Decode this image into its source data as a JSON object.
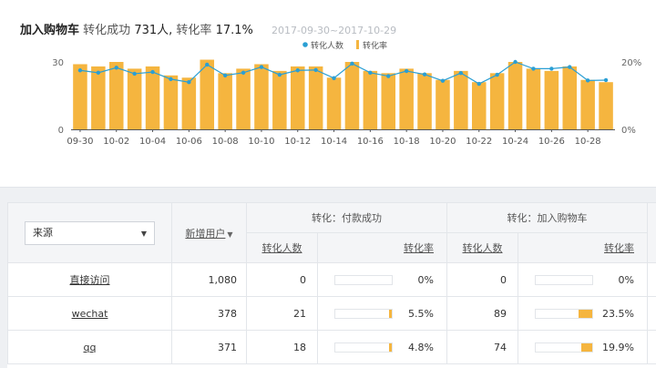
{
  "headline": {
    "title": "加入购物车",
    "conv_label": "转化成功",
    "conv_count": "731人,",
    "rate_label": "转化率",
    "rate_value": "17.1%",
    "date_range": "2017-09-30~2017-10-29"
  },
  "chart_data": {
    "type": "bar",
    "legend_placement": "top-center",
    "grid": false,
    "categories": [
      "09-30",
      "10-01",
      "10-02",
      "10-03",
      "10-04",
      "10-05",
      "10-06",
      "10-07",
      "10-08",
      "10-09",
      "10-10",
      "10-11",
      "10-12",
      "10-13",
      "10-14",
      "10-15",
      "10-16",
      "10-17",
      "10-18",
      "10-19",
      "10-20",
      "10-21",
      "10-22",
      "10-23",
      "10-24",
      "10-25",
      "10-26",
      "10-27",
      "10-28",
      "10-29"
    ],
    "tick_labels": [
      "09-30",
      "10-02",
      "10-04",
      "10-06",
      "10-08",
      "10-10",
      "10-12",
      "10-14",
      "10-16",
      "10-18",
      "10-20",
      "10-22",
      "10-24",
      "10-26",
      "10-28"
    ],
    "left_axis": {
      "ticks": [
        "0",
        "30"
      ],
      "range": [
        0,
        30
      ]
    },
    "right_axis": {
      "ticks": [
        "0%",
        "20%"
      ],
      "range": [
        0,
        20
      ]
    },
    "series": [
      {
        "name": "转化人数",
        "kind": "bar",
        "color": "#f5b53f",
        "values": [
          29,
          28,
          30,
          27,
          28,
          24,
          23,
          31,
          25,
          27,
          29,
          26,
          28,
          28,
          23,
          30,
          26,
          25,
          27,
          25,
          22,
          26,
          21,
          25,
          30,
          27,
          26,
          28,
          22,
          21
        ]
      },
      {
        "name": "转化率",
        "kind": "line",
        "color": "#2b9fd4",
        "values": [
          17.5,
          16.8,
          18.3,
          16.5,
          17.0,
          14.9,
          14.0,
          19.2,
          16.0,
          16.8,
          18.5,
          16.2,
          17.5,
          17.6,
          15.2,
          19.5,
          16.8,
          15.8,
          17.3,
          16.3,
          14.4,
          16.7,
          13.5,
          16.2,
          20.0,
          18.0,
          18.0,
          18.5,
          14.5,
          14.6
        ]
      }
    ]
  },
  "table": {
    "source_select_value": "来源",
    "new_users_header": "新增用户",
    "group1_header": "转化：付款成功",
    "group2_header": "转化：加入购物车",
    "count_header": "转化人数",
    "rate_header": "转化率",
    "rows": [
      {
        "source": "直接访问",
        "new_users": "1,080",
        "pay_count": "0",
        "pay_rate": "0%",
        "pay_rate_num": 0,
        "cart_count": "0",
        "cart_rate": "0%",
        "cart_rate_num": 0
      },
      {
        "source": "wechat",
        "new_users": "378",
        "pay_count": "21",
        "pay_rate": "5.5%",
        "pay_rate_num": 5.5,
        "cart_count": "89",
        "cart_rate": "23.5%",
        "cart_rate_num": 23.5
      },
      {
        "source": "qq",
        "new_users": "371",
        "pay_count": "18",
        "pay_rate": "4.8%",
        "pay_rate_num": 4.8,
        "cart_count": "74",
        "cart_rate": "19.9%",
        "cart_rate_num": 19.9
      }
    ]
  }
}
